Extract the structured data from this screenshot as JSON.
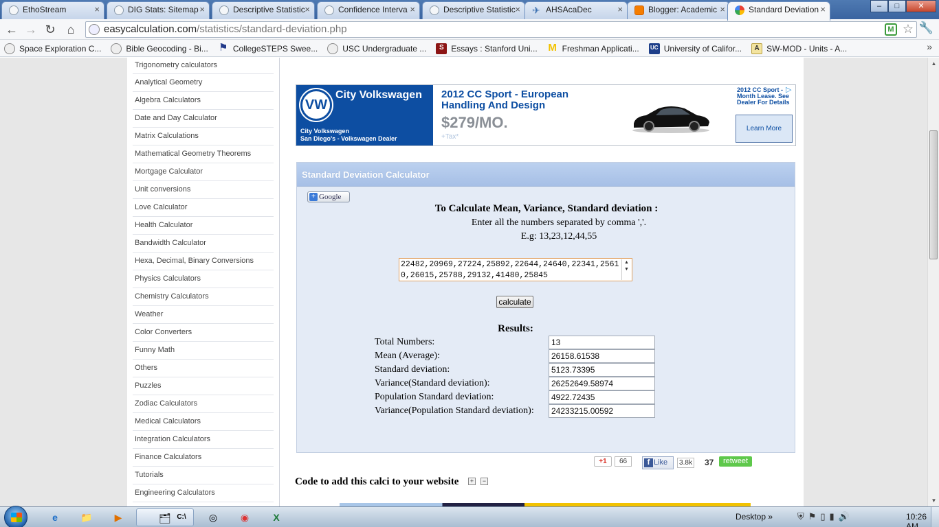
{
  "browser": {
    "tabs": [
      {
        "title": "EthoStream",
        "icon": "globe"
      },
      {
        "title": "DIG Stats: Sitemap",
        "icon": "globe"
      },
      {
        "title": "Descriptive Statistic",
        "icon": "globe"
      },
      {
        "title": "Confidence Interva",
        "icon": "globe"
      },
      {
        "title": "Descriptive Statistic",
        "icon": "globe"
      },
      {
        "title": "AHSAcaDec",
        "icon": "acadec"
      },
      {
        "title": "Blogger: Academic",
        "icon": "blogger"
      },
      {
        "title": "Standard Deviation",
        "icon": "google",
        "active": true
      }
    ],
    "url_host": "easycalculation.com",
    "url_path": "/statistics/standard-deviation.php",
    "bookmarks": [
      {
        "label": "Space Exploration C...",
        "icon": "globe"
      },
      {
        "label": "Bible Geocoding - Bi...",
        "icon": "globe"
      },
      {
        "label": "CollegeSTEPS Swee...",
        "icon": "flag"
      },
      {
        "label": "USC Undergraduate ...",
        "icon": "globe"
      },
      {
        "label": "Essays : Stanford Uni...",
        "icon": "S"
      },
      {
        "label": "Freshman Applicati...",
        "icon": "M"
      },
      {
        "label": "University of Califor...",
        "icon": "UC"
      },
      {
        "label": "SW-MOD - Units - A...",
        "icon": "A"
      }
    ]
  },
  "sidebar": {
    "items": [
      "Trigonometry calculators",
      "Analytical Geometry",
      "Algebra Calculators",
      "Date and Day Calculator",
      "Matrix Calculations",
      "Mathematical Geometry Theorems",
      "Mortgage Calculator",
      "Unit conversions",
      "Love Calculator",
      "Health Calculator",
      "Bandwidth Calculator",
      "Hexa, Decimal, Binary Conversions",
      "Physics Calculators",
      "Chemistry Calculators",
      "Weather",
      "Color Converters",
      "Funny Math",
      "Others",
      "Puzzles",
      "Zodiac Calculators",
      "Medical Calculators",
      "Integration Calculators",
      "Finance Calculators",
      "Tutorials",
      "Engineering Calculators"
    ]
  },
  "ad": {
    "brand": "City Volkswagen",
    "logo": "VW",
    "dealer_line1": "City Volkswagen",
    "dealer_line2": "San Diego's - Volkswagen Dealer",
    "headline": "2012 CC Sport - European Handling And Design",
    "price": "$279/MO.",
    "tax": "+Tax*",
    "small_text": "2012 CC Sport - Month Lease. See Dealer For Details",
    "cta": "Learn More",
    "adchoice": "▷"
  },
  "calculator": {
    "header": "Standard Deviation Calculator",
    "google_button": "Google",
    "title": "To Calculate Mean, Variance, Standard deviation :",
    "instruction": "Enter all the numbers separated by comma ','.",
    "example": "E.g: 13,23,12,44,55",
    "input_value": "22482,20969,27224,25892,22644,24640,22341,25610,26015,25788,29132,41480,25845",
    "button": "calculate",
    "results_title": "Results:",
    "results": [
      {
        "label": "Total Numbers:",
        "value": "13"
      },
      {
        "label": "Mean (Average):",
        "value": "26158.61538"
      },
      {
        "label": "Standard deviation:",
        "value": "5123.73395"
      },
      {
        "label": "Variance(Standard deviation):",
        "value": "26252649.58974"
      },
      {
        "label": "Population Standard deviation:",
        "value": "4922.72435"
      },
      {
        "label": "Variance(Population Standard deviation):",
        "value": "24233215.00592"
      }
    ]
  },
  "social": {
    "gplus_label": "+1",
    "gplus_count": "66",
    "fb_label": "Like",
    "fb_count": "3.8k",
    "tweet_count": "37",
    "retweet_label": "retweet"
  },
  "code_section": {
    "title": "Code to add this calci to your website",
    "expand": "+",
    "collapse": "−"
  },
  "taskbar": {
    "desktop_label": "Desktop",
    "clock": "10:26 AM"
  },
  "colors": {
    "vw_blue": "#0d4ea2",
    "calc_header": "#a6bfe6",
    "calc_body": "#e4ebf6",
    "retweet_green": "#5ec84b"
  }
}
